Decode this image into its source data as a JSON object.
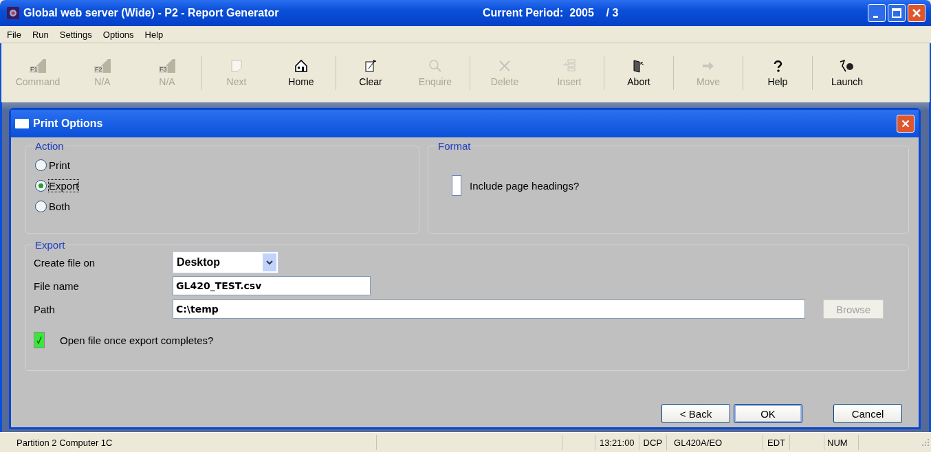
{
  "window": {
    "title": "Global web server (Wide) - P2 - Report Generator",
    "period": "Current Period:  2005    / 3"
  },
  "menu": [
    "File",
    "Run",
    "Settings",
    "Options",
    "Help"
  ],
  "toolbar": [
    {
      "label": "Command",
      "key": "F1",
      "disabled": true
    },
    {
      "label": "N/A",
      "key": "F2",
      "disabled": true
    },
    {
      "label": "N/A",
      "key": "F3",
      "disabled": true
    },
    {
      "label": "Next",
      "disabled": true
    },
    {
      "label": "Home",
      "disabled": false
    },
    {
      "label": "Clear",
      "disabled": false
    },
    {
      "label": "Enquire",
      "disabled": true
    },
    {
      "label": "Delete",
      "disabled": true
    },
    {
      "label": "Insert",
      "disabled": true
    },
    {
      "label": "Abort",
      "disabled": false
    },
    {
      "label": "Move",
      "disabled": true
    },
    {
      "label": "Help",
      "disabled": false
    },
    {
      "label": "Launch",
      "disabled": false
    }
  ],
  "dialog": {
    "title": "Print Options",
    "action": {
      "legend": "Action",
      "options": [
        {
          "label": "Print",
          "selected": false
        },
        {
          "label": "Export",
          "selected": true
        },
        {
          "label": "Both",
          "selected": false
        }
      ]
    },
    "format": {
      "legend": "Format",
      "include_page_headings": {
        "label": "Include page headings?",
        "checked": false
      }
    },
    "export": {
      "legend": "Export",
      "create_file_on": {
        "label": "Create file on",
        "value": "Desktop"
      },
      "file_name": {
        "label": "File name",
        "value": "GL420_TEST.csv"
      },
      "path": {
        "label": "Path",
        "value": "C:\\temp"
      },
      "browse": {
        "label": "Browse",
        "disabled": true
      },
      "open_file": {
        "label": "Open file once export completes?",
        "checked": true
      }
    },
    "buttons": [
      {
        "label": "< Back",
        "kind": "normal"
      },
      {
        "label": "OK",
        "kind": "default"
      },
      {
        "label": "Cancel",
        "kind": "cancel"
      }
    ]
  },
  "status_bar": [
    {
      "text": "Partition 2 Computer 1C",
      "kind": "wide"
    },
    {
      "text": "13:21:00",
      "kind": "cell"
    },
    {
      "text": "DCP",
      "kind": "cell"
    },
    {
      "text": "GL420A/EO",
      "kind": "mid"
    },
    {
      "text": "EDT",
      "kind": "cell"
    },
    {
      "text": "NUM",
      "kind": "end"
    }
  ]
}
